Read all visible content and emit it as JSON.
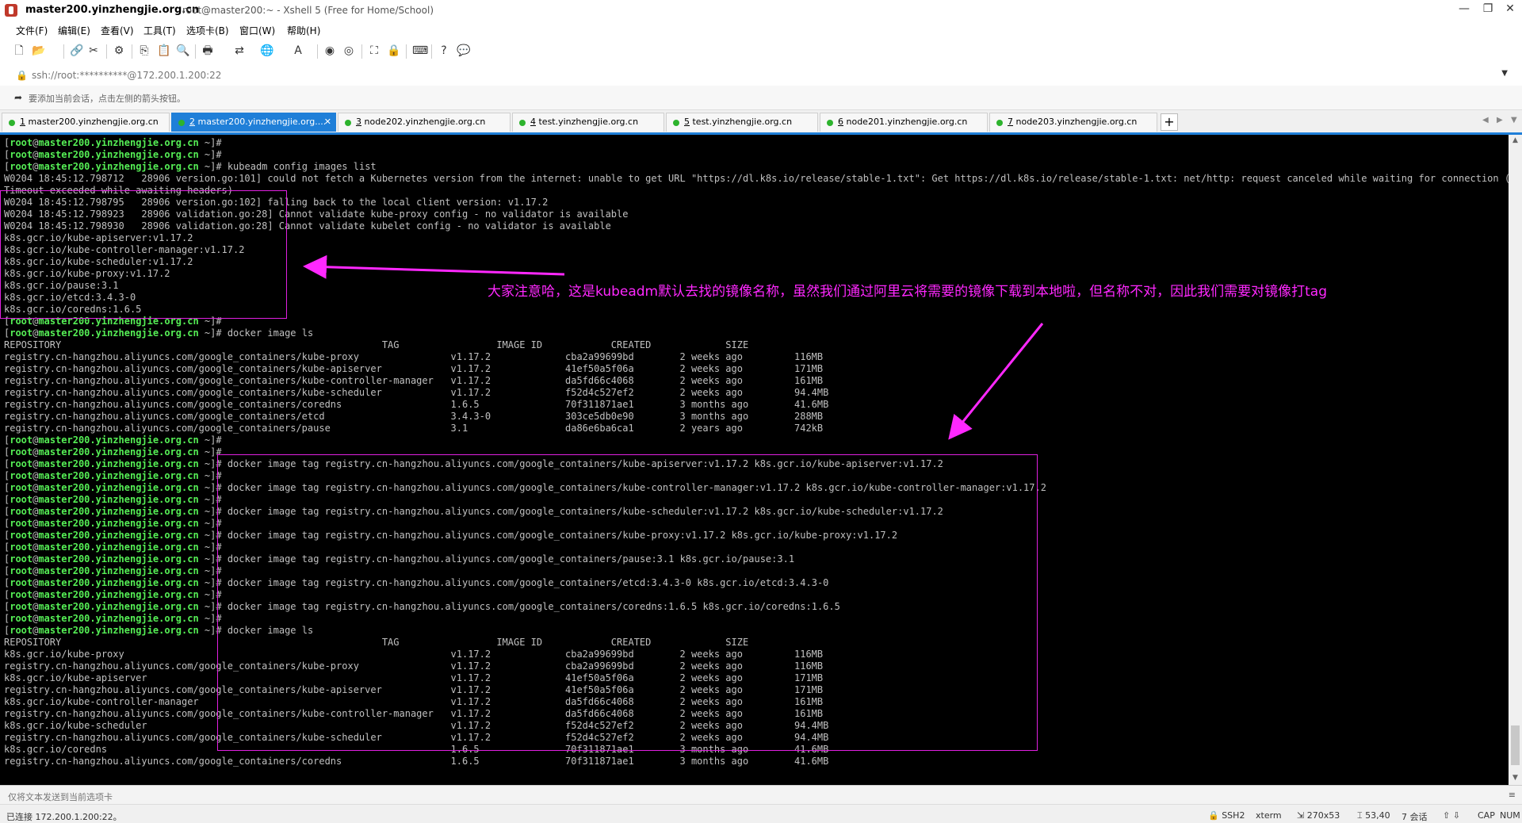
{
  "window": {
    "title": "master200.yinzhengjie.org.cn",
    "subtitle": "root@master200:~ - Xshell 5 (Free for Home/School)",
    "buttons": [
      "—",
      "❐",
      "✕"
    ]
  },
  "menu": [
    "文件(F)",
    "编辑(E)",
    "查看(V)",
    "工具(T)",
    "选项卡(B)",
    "窗口(W)",
    "帮助(H)"
  ],
  "address": {
    "value": "ssh://root:**********@172.200.1.200:22"
  },
  "hint": "要添加当前会话，点击左侧的箭头按钮。",
  "tabs": [
    {
      "num": "1",
      "label": " master200.yinzhengjie.org.cn",
      "active": false
    },
    {
      "num": "2",
      "label": " master200.yinzhengjie.org....",
      "active": true
    },
    {
      "num": "3",
      "label": " node202.yinzhengjie.org.cn",
      "active": false
    },
    {
      "num": "4",
      "label": " test.yinzhengjie.org.cn",
      "active": false
    },
    {
      "num": "5",
      "label": " test.yinzhengjie.org.cn",
      "active": false
    },
    {
      "num": "6",
      "label": " node201.yinzhengjie.org.cn",
      "active": false
    },
    {
      "num": "7",
      "label": " node203.yinzhengjie.org.cn",
      "active": false
    }
  ],
  "prompt": {
    "open": "[",
    "user": "root",
    "at": "@",
    "host": "master200.yinzhengjie.org.cn",
    "close": " ~]",
    "sign": "#"
  },
  "terminal_lines": [
    {
      "t": "p",
      "c": ""
    },
    {
      "t": "p",
      "c": ""
    },
    {
      "t": "p",
      "c": " kubeadm config images list"
    },
    {
      "t": "o",
      "c": "W0204 18:45:12.798712   28906 version.go:101] could not fetch a Kubernetes version from the internet: unable to get URL \"https://dl.k8s.io/release/stable-1.txt\": Get https://dl.k8s.io/release/stable-1.txt: net/http: request canceled while waiting for connection (Client."
    },
    {
      "t": "o",
      "c": "Timeout exceeded while awaiting headers)"
    },
    {
      "t": "o",
      "c": "W0204 18:45:12.798795   28906 version.go:102] falling back to the local client version: v1.17.2"
    },
    {
      "t": "o",
      "c": "W0204 18:45:12.798923   28906 validation.go:28] Cannot validate kube-proxy config - no validator is available"
    },
    {
      "t": "o",
      "c": "W0204 18:45:12.798930   28906 validation.go:28] Cannot validate kubelet config - no validator is available"
    },
    {
      "t": "o",
      "c": "k8s.gcr.io/kube-apiserver:v1.17.2"
    },
    {
      "t": "o",
      "c": "k8s.gcr.io/kube-controller-manager:v1.17.2"
    },
    {
      "t": "o",
      "c": "k8s.gcr.io/kube-scheduler:v1.17.2"
    },
    {
      "t": "o",
      "c": "k8s.gcr.io/kube-proxy:v1.17.2"
    },
    {
      "t": "o",
      "c": "k8s.gcr.io/pause:3.1"
    },
    {
      "t": "o",
      "c": "k8s.gcr.io/etcd:3.4.3-0"
    },
    {
      "t": "o",
      "c": "k8s.gcr.io/coredns:1.6.5"
    },
    {
      "t": "p",
      "c": ""
    },
    {
      "t": "p",
      "c": " docker image ls"
    },
    {
      "t": "o",
      "c": "REPOSITORY                                                        TAG                 IMAGE ID            CREATED             SIZE"
    },
    {
      "t": "o",
      "c": "registry.cn-hangzhou.aliyuncs.com/google_containers/kube-proxy                v1.17.2             cba2a99699bd        2 weeks ago         116MB"
    },
    {
      "t": "o",
      "c": "registry.cn-hangzhou.aliyuncs.com/google_containers/kube-apiserver            v1.17.2             41ef50a5f06a        2 weeks ago         171MB"
    },
    {
      "t": "o",
      "c": "registry.cn-hangzhou.aliyuncs.com/google_containers/kube-controller-manager   v1.17.2             da5fd66c4068        2 weeks ago         161MB"
    },
    {
      "t": "o",
      "c": "registry.cn-hangzhou.aliyuncs.com/google_containers/kube-scheduler            v1.17.2             f52d4c527ef2        2 weeks ago         94.4MB"
    },
    {
      "t": "o",
      "c": "registry.cn-hangzhou.aliyuncs.com/google_containers/coredns                   1.6.5               70f311871ae1        3 months ago        41.6MB"
    },
    {
      "t": "o",
      "c": "registry.cn-hangzhou.aliyuncs.com/google_containers/etcd                      3.4.3-0             303ce5db0e90        3 months ago        288MB"
    },
    {
      "t": "o",
      "c": "registry.cn-hangzhou.aliyuncs.com/google_containers/pause                     3.1                 da86e6ba6ca1        2 years ago         742kB"
    },
    {
      "t": "p",
      "c": ""
    },
    {
      "t": "p",
      "c": ""
    },
    {
      "t": "p",
      "c": " docker image tag registry.cn-hangzhou.aliyuncs.com/google_containers/kube-apiserver:v1.17.2 k8s.gcr.io/kube-apiserver:v1.17.2"
    },
    {
      "t": "p",
      "c": ""
    },
    {
      "t": "p",
      "c": " docker image tag registry.cn-hangzhou.aliyuncs.com/google_containers/kube-controller-manager:v1.17.2 k8s.gcr.io/kube-controller-manager:v1.17.2"
    },
    {
      "t": "p",
      "c": ""
    },
    {
      "t": "p",
      "c": " docker image tag registry.cn-hangzhou.aliyuncs.com/google_containers/kube-scheduler:v1.17.2 k8s.gcr.io/kube-scheduler:v1.17.2"
    },
    {
      "t": "p",
      "c": ""
    },
    {
      "t": "p",
      "c": " docker image tag registry.cn-hangzhou.aliyuncs.com/google_containers/kube-proxy:v1.17.2 k8s.gcr.io/kube-proxy:v1.17.2"
    },
    {
      "t": "p",
      "c": ""
    },
    {
      "t": "p",
      "c": " docker image tag registry.cn-hangzhou.aliyuncs.com/google_containers/pause:3.1 k8s.gcr.io/pause:3.1"
    },
    {
      "t": "p",
      "c": ""
    },
    {
      "t": "p",
      "c": " docker image tag registry.cn-hangzhou.aliyuncs.com/google_containers/etcd:3.4.3-0 k8s.gcr.io/etcd:3.4.3-0"
    },
    {
      "t": "p",
      "c": ""
    },
    {
      "t": "p",
      "c": " docker image tag registry.cn-hangzhou.aliyuncs.com/google_containers/coredns:1.6.5 k8s.gcr.io/coredns:1.6.5"
    },
    {
      "t": "p",
      "c": ""
    },
    {
      "t": "p",
      "c": " docker image ls"
    },
    {
      "t": "o",
      "c": "REPOSITORY                                                        TAG                 IMAGE ID            CREATED             SIZE"
    },
    {
      "t": "o",
      "c": "k8s.gcr.io/kube-proxy                                                         v1.17.2             cba2a99699bd        2 weeks ago         116MB"
    },
    {
      "t": "o",
      "c": "registry.cn-hangzhou.aliyuncs.com/google_containers/kube-proxy                v1.17.2             cba2a99699bd        2 weeks ago         116MB"
    },
    {
      "t": "o",
      "c": "k8s.gcr.io/kube-apiserver                                                     v1.17.2             41ef50a5f06a        2 weeks ago         171MB"
    },
    {
      "t": "o",
      "c": "registry.cn-hangzhou.aliyuncs.com/google_containers/kube-apiserver            v1.17.2             41ef50a5f06a        2 weeks ago         171MB"
    },
    {
      "t": "o",
      "c": "k8s.gcr.io/kube-controller-manager                                            v1.17.2             da5fd66c4068        2 weeks ago         161MB"
    },
    {
      "t": "o",
      "c": "registry.cn-hangzhou.aliyuncs.com/google_containers/kube-controller-manager   v1.17.2             da5fd66c4068        2 weeks ago         161MB"
    },
    {
      "t": "o",
      "c": "k8s.gcr.io/kube-scheduler                                                     v1.17.2             f52d4c527ef2        2 weeks ago         94.4MB"
    },
    {
      "t": "o",
      "c": "registry.cn-hangzhou.aliyuncs.com/google_containers/kube-scheduler            v1.17.2             f52d4c527ef2        2 weeks ago         94.4MB"
    },
    {
      "t": "o",
      "c": "k8s.gcr.io/coredns                                                            1.6.5               70f311871ae1        3 months ago        41.6MB"
    },
    {
      "t": "o",
      "c": "registry.cn-hangzhou.aliyuncs.com/google_containers/coredns                   1.6.5               70f311871ae1        3 months ago        41.6MB"
    }
  ],
  "annotation": "大家注意哈，这是kubeadm默认去找的镜像名称，虽然我们通过阿里云将需要的镜像下载到本地啦，但名称不对，因此我们需要对镜像打tag",
  "annotation_color": "#ff28ff",
  "send_bar": "仅将文本发送到当前选项卡",
  "status": {
    "connection": "已连接 172.200.1.200:22。",
    "protocol": "SSH2",
    "terminal": "xterm",
    "size": "270x53",
    "cursor": "53,40",
    "sessions": "7 会话",
    "cap": "CAP",
    "num": "NUM"
  },
  "colors": {
    "tab_active": "#1f7fd8",
    "prompt_green": "#55ee55",
    "terminal_text": "#c0c0c0"
  }
}
